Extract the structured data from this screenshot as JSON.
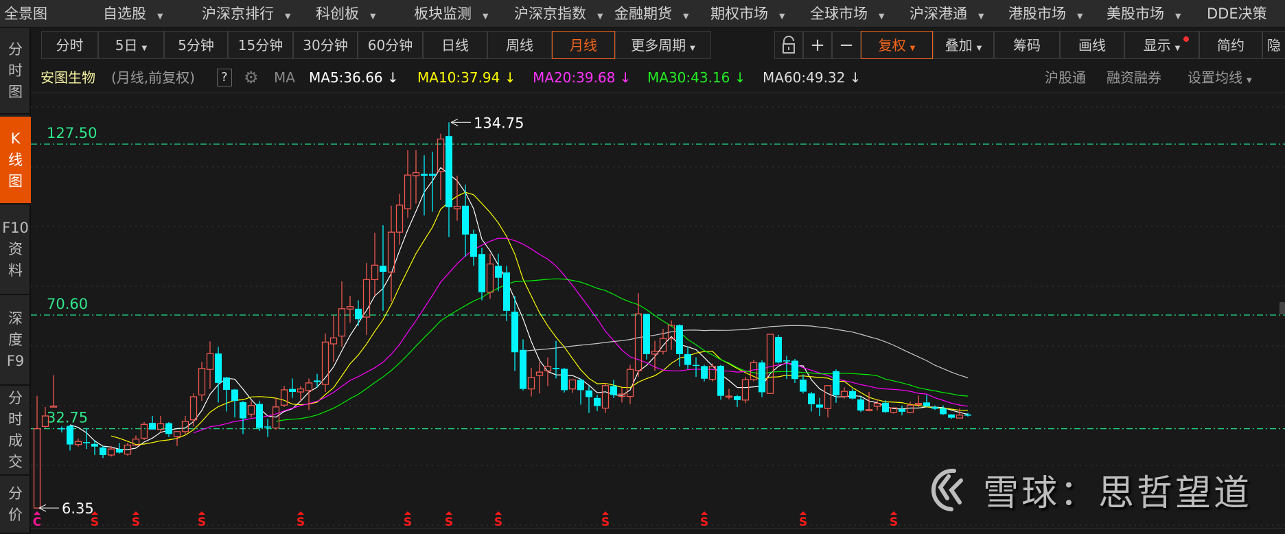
{
  "topmenu": [
    {
      "label": "全景图",
      "arrow": false
    },
    {
      "label": "自选股",
      "arrow": true
    },
    {
      "label": "沪深京排行",
      "arrow": true
    },
    {
      "label": "科创板",
      "arrow": true
    },
    {
      "label": "板块监测",
      "arrow": true
    },
    {
      "label": "沪深京指数",
      "arrow": true
    },
    {
      "label": "金融期货",
      "arrow": true
    },
    {
      "label": "期权市场",
      "arrow": true
    },
    {
      "label": "全球市场",
      "arrow": true
    },
    {
      "label": "沪深港通",
      "arrow": true
    },
    {
      "label": "港股市场",
      "arrow": true
    },
    {
      "label": "美股市场",
      "arrow": true
    },
    {
      "label": "DDE决策",
      "arrow": false
    }
  ],
  "sidebar": [
    {
      "label": "分\n时\n图"
    },
    {
      "label": "K\n线\n图",
      "active": true
    },
    {
      "label": "F10\n资\n料"
    },
    {
      "label": "深\n度\nF9"
    },
    {
      "label": "分\n时\n成\n交"
    },
    {
      "label": "分\n价"
    }
  ],
  "periods": [
    "分时",
    "5日",
    "5分钟",
    "15分钟",
    "30分钟",
    "60分钟",
    "日线",
    "周线",
    "月线",
    "更多周期"
  ],
  "active_period": "月线",
  "tools": {
    "lock": "lock-icon",
    "plus": "+",
    "minus": "−",
    "fuquan": "复权",
    "diejia": "叠加",
    "chouma": "筹码",
    "huaxian": "画线",
    "xianshi": "显示",
    "jianyue": "简约",
    "yin": "隐"
  },
  "info": {
    "stock": "安图生物",
    "mode": "(月线,前复权)",
    "help": "?",
    "ma": "MA",
    "ma5": "MA5:36.66",
    "ma10": "MA10:37.94",
    "ma20": "MA20:39.68",
    "ma30": "MA30:43.16",
    "ma60": "MA60:49.32",
    "arrow": "↓",
    "hgt": "沪股通",
    "rzrq": "融资融券",
    "szjx": "设置均线"
  },
  "colors": {
    "up": "#f0584f",
    "down": "#00f5ff",
    "ma5": "#ffffff",
    "ma10": "#ffff00",
    "ma20": "#ff00ff",
    "ma30": "#00ee00",
    "ma60": "#c8c8c8",
    "ref": "#1fe08a",
    "accent": "#e65100"
  },
  "watermark": "雪球：思哲望道",
  "chart_data": {
    "type": "candlestick",
    "period": "monthly",
    "price_range": [
      6.35,
      134.75
    ],
    "ref_lines": [
      "127.50",
      "70.60",
      "32.75"
    ],
    "high_label": "134.75",
    "low_label": "6.35",
    "high_index": 50,
    "low_index": 0,
    "markers": [
      {
        "i": 0,
        "t": "C",
        "c": "#ff1493"
      },
      {
        "i": 7,
        "t": "S",
        "c": "#ff1a1a"
      },
      {
        "i": 12,
        "t": "S",
        "c": "#ff1a1a"
      },
      {
        "i": 20,
        "t": "S",
        "c": "#ff1a1a"
      },
      {
        "i": 32,
        "t": "S",
        "c": "#ff1a1a"
      },
      {
        "i": 45,
        "t": "S",
        "c": "#ff1a1a"
      },
      {
        "i": 50,
        "t": "S",
        "c": "#ff1a1a"
      },
      {
        "i": 56,
        "t": "S",
        "c": "#ff1a1a"
      },
      {
        "i": 69,
        "t": "S",
        "c": "#ff1a1a"
      },
      {
        "i": 81,
        "t": "S",
        "c": "#ff1a1a"
      },
      {
        "i": 93,
        "t": "S",
        "c": "#ff1a1a"
      },
      {
        "i": 104,
        "t": "S",
        "c": "#ff1a1a"
      }
    ],
    "ma_periods": [
      5,
      10,
      20,
      30,
      60
    ],
    "ohlc": [
      [
        6.35,
        43.7,
        6.35,
        32.75
      ],
      [
        33.5,
        40,
        32.8,
        37
      ],
      [
        40,
        50.6,
        39.8,
        40.3
      ],
      [
        32.9,
        33.5,
        31.5,
        32.6
      ],
      [
        33.7,
        34,
        25.5,
        27.5
      ],
      [
        27.5,
        29.5,
        26.8,
        28.5
      ],
      [
        28.3,
        33,
        26,
        28
      ],
      [
        27.7,
        29,
        24,
        26.8
      ],
      [
        26.5,
        27,
        23,
        24
      ],
      [
        24,
        27,
        23.5,
        26
      ],
      [
        26,
        28,
        24.5,
        24.8
      ],
      [
        24.3,
        28,
        23.8,
        27.3
      ],
      [
        27.3,
        30.5,
        27,
        29.3
      ],
      [
        29.6,
        35,
        29,
        34.2
      ],
      [
        34.7,
        37,
        33,
        32.5
      ],
      [
        32.5,
        37,
        31.5,
        34.4
      ],
      [
        34.6,
        35,
        30,
        31
      ],
      [
        30.2,
        32,
        27,
        31.8
      ],
      [
        31.8,
        37,
        31,
        35.2
      ],
      [
        35.7,
        44.5,
        33.5,
        43.4
      ],
      [
        44,
        55,
        42,
        52.8
      ],
      [
        52.5,
        61.8,
        46,
        57.8
      ],
      [
        57.8,
        60,
        41.5,
        48
      ],
      [
        49.8,
        50,
        38.5,
        45.7
      ],
      [
        45.8,
        46,
        36.5,
        42
      ],
      [
        41.6,
        42,
        31,
        36.2
      ],
      [
        37.6,
        42,
        36.5,
        40.5
      ],
      [
        41,
        42,
        32,
        33
      ],
      [
        33.5,
        36,
        30,
        33.3
      ],
      [
        33,
        43,
        32.5,
        40
      ],
      [
        40.6,
        47,
        40,
        45.7
      ],
      [
        46,
        49.5,
        43,
        45
      ],
      [
        45,
        47,
        42,
        46
      ],
      [
        45.5,
        49.5,
        39,
        48
      ],
      [
        48.8,
        51,
        46.5,
        48.3
      ],
      [
        47.5,
        64.5,
        45,
        61.6
      ],
      [
        61,
        70.6,
        55,
        63
      ],
      [
        63.6,
        81.8,
        60,
        72.7
      ],
      [
        72.6,
        77,
        68,
        73.4
      ],
      [
        72.7,
        75.5,
        67,
        69.2
      ],
      [
        69.9,
        88,
        64,
        82.4
      ],
      [
        82.4,
        98,
        77,
        87.2
      ],
      [
        87,
        100.5,
        72,
        85
      ],
      [
        84.9,
        107,
        75,
        98.2
      ],
      [
        98.2,
        111,
        94,
        107.2
      ],
      [
        106,
        125.5,
        103,
        117.2
      ],
      [
        117,
        125.5,
        107.7,
        118
      ],
      [
        117.6,
        123.8,
        103.8,
        117
      ],
      [
        117.6,
        125,
        105,
        117
      ],
      [
        118.4,
        131,
        109,
        129.2
      ],
      [
        130.2,
        134.75,
        96.6,
        106.5
      ],
      [
        106,
        117,
        102,
        106.8
      ],
      [
        107,
        114,
        90,
        97.4
      ],
      [
        97.6,
        99,
        87,
        90
      ],
      [
        90.9,
        93,
        75.5,
        78.2
      ],
      [
        78.2,
        91,
        76,
        87.6
      ],
      [
        87,
        91,
        78.5,
        83
      ],
      [
        84.8,
        87,
        68.6,
        72
      ],
      [
        71.7,
        77,
        52,
        58.2
      ],
      [
        59,
        62.5,
        45.5,
        46
      ],
      [
        46,
        53,
        43.5,
        49.8
      ],
      [
        50.5,
        55,
        44.5,
        51.6
      ],
      [
        52,
        56.5,
        47,
        53.5
      ],
      [
        53,
        62,
        49.5,
        52.6
      ],
      [
        52.7,
        53,
        44.8,
        45.6
      ],
      [
        46,
        49.2,
        44.7,
        49
      ],
      [
        49,
        49.5,
        40.8,
        45.6
      ],
      [
        45.5,
        47,
        38,
        43.3
      ],
      [
        43,
        44,
        38.6,
        40.3
      ],
      [
        39.6,
        48,
        38,
        47.1
      ],
      [
        47,
        49,
        43,
        44
      ],
      [
        43.5,
        46.5,
        41.5,
        44.3
      ],
      [
        43.5,
        54,
        41,
        52.5
      ],
      [
        52.1,
        77.9,
        50,
        71
      ],
      [
        71,
        71,
        55.8,
        57.6
      ],
      [
        57.6,
        62,
        52,
        58.5
      ],
      [
        58.5,
        66,
        57.5,
        62.8
      ],
      [
        62.8,
        68.8,
        59,
        67.2
      ],
      [
        67.2,
        67.5,
        53.5,
        57.6
      ],
      [
        57.6,
        60,
        52.6,
        54
      ],
      [
        54,
        56.5,
        50,
        53.8
      ],
      [
        53.6,
        54,
        48.5,
        49.4
      ],
      [
        49.2,
        54.5,
        48.5,
        53.5
      ],
      [
        53.7,
        54,
        42.4,
        43.7
      ],
      [
        43.6,
        46,
        42.5,
        43.6
      ],
      [
        43.6,
        44,
        40,
        42.3
      ],
      [
        42.3,
        50,
        41.3,
        49.1
      ],
      [
        49.1,
        55.7,
        48.5,
        54.8
      ],
      [
        54.8,
        55.5,
        43.3,
        44.9
      ],
      [
        44.5,
        64.2,
        44.5,
        64.2
      ],
      [
        63.3,
        64,
        54.5,
        54.8
      ],
      [
        55.5,
        57,
        49.3,
        55.2
      ],
      [
        55.4,
        56,
        48,
        49.3
      ],
      [
        49.1,
        50.8,
        44.5,
        45.1
      ],
      [
        44.5,
        45,
        38.5,
        40.9
      ],
      [
        40.8,
        43,
        37,
        39.8
      ],
      [
        39.5,
        47.2,
        36.5,
        47.1
      ],
      [
        51.9,
        52.5,
        41.4,
        43.9
      ],
      [
        43.5,
        46.5,
        42.8,
        45.2
      ],
      [
        45.3,
        46,
        42.5,
        42.8
      ],
      [
        42.5,
        43.5,
        38.3,
        38.8
      ],
      [
        39,
        45,
        38.8,
        39.1
      ],
      [
        40.2,
        42.5,
        38.8,
        41.2
      ],
      [
        41.4,
        42.2,
        38,
        38.3
      ],
      [
        38.2,
        39.8,
        37.8,
        39.7
      ],
      [
        39.3,
        40.5,
        37.2,
        38.4
      ],
      [
        38.2,
        41.8,
        38,
        40.6
      ],
      [
        40.8,
        43.8,
        40,
        41.2
      ],
      [
        41.5,
        44,
        40,
        40.2
      ],
      [
        40,
        40.5,
        39,
        39.4
      ],
      [
        39.5,
        40.5,
        37.3,
        37.6
      ],
      [
        37.5,
        37.6,
        36,
        36.4
      ],
      [
        36.3,
        39.5,
        36.2,
        37.3
      ],
      [
        37.5,
        38,
        36.8,
        37.1
      ]
    ]
  }
}
